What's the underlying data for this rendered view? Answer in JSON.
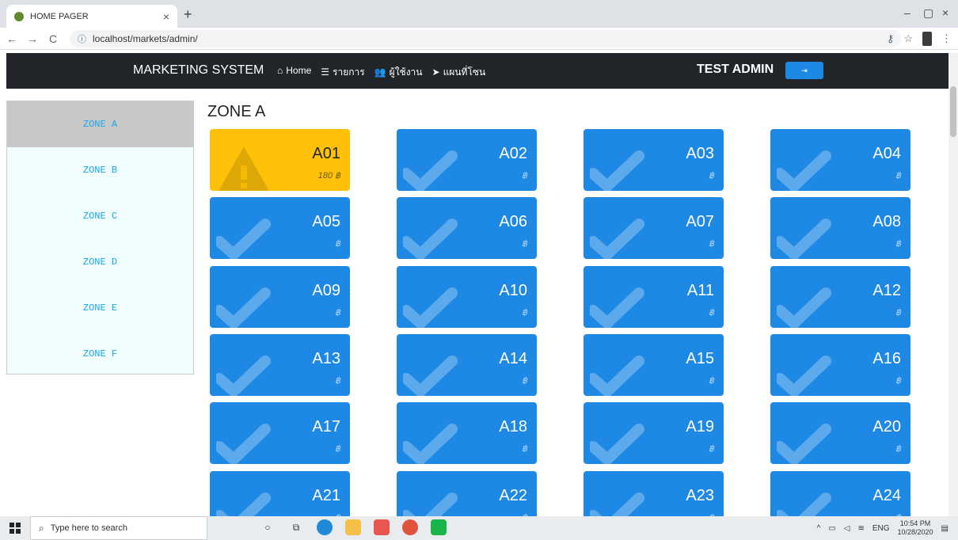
{
  "browser": {
    "tab_title": "HOME PAGER",
    "tab_close": "×",
    "new_tab": "+",
    "url": "localhost/markets/admin/",
    "win_min": "–",
    "win_max": "▢",
    "win_close": "×",
    "back": "←",
    "forward": "→",
    "reload": "C",
    "info": "ⓘ",
    "key": "⚷",
    "star": "☆",
    "menu": "⋮"
  },
  "navbar": {
    "brand": "MARKETING SYSTEM",
    "links": [
      {
        "icon": "home-icon",
        "glyph": "⌂",
        "label": "Home"
      },
      {
        "icon": "list-icon",
        "glyph": "☰",
        "label": "รายการ"
      },
      {
        "icon": "users-icon",
        "glyph": "👥",
        "label": "ผู้ใช้งาน"
      },
      {
        "icon": "send-icon",
        "glyph": "➤",
        "label": "แผนที่โซน"
      }
    ],
    "user": "TEST ADMIN",
    "logout_glyph": "⇥"
  },
  "sidebar": {
    "zones": [
      "ZONE A",
      "ZONE B",
      "ZONE C",
      "ZONE D",
      "ZONE E",
      "ZONE F"
    ],
    "active": "ZONE A"
  },
  "main": {
    "title": "ZONE A",
    "booths": [
      {
        "id": "A01",
        "price": "180 ฿",
        "status": "warning"
      },
      {
        "id": "A02",
        "price": "฿",
        "status": "available"
      },
      {
        "id": "A03",
        "price": "฿",
        "status": "available"
      },
      {
        "id": "A04",
        "price": "฿",
        "status": "available"
      },
      {
        "id": "A05",
        "price": "฿",
        "status": "available"
      },
      {
        "id": "A06",
        "price": "฿",
        "status": "available"
      },
      {
        "id": "A07",
        "price": "฿",
        "status": "available"
      },
      {
        "id": "A08",
        "price": "฿",
        "status": "available"
      },
      {
        "id": "A09",
        "price": "฿",
        "status": "available"
      },
      {
        "id": "A10",
        "price": "฿",
        "status": "available"
      },
      {
        "id": "A11",
        "price": "฿",
        "status": "available"
      },
      {
        "id": "A12",
        "price": "฿",
        "status": "available"
      },
      {
        "id": "A13",
        "price": "฿",
        "status": "available"
      },
      {
        "id": "A14",
        "price": "฿",
        "status": "available"
      },
      {
        "id": "A15",
        "price": "฿",
        "status": "available"
      },
      {
        "id": "A16",
        "price": "฿",
        "status": "available"
      },
      {
        "id": "A17",
        "price": "฿",
        "status": "available"
      },
      {
        "id": "A18",
        "price": "฿",
        "status": "available"
      },
      {
        "id": "A19",
        "price": "฿",
        "status": "available"
      },
      {
        "id": "A20",
        "price": "฿",
        "status": "available"
      },
      {
        "id": "A21",
        "price": "฿",
        "status": "available"
      },
      {
        "id": "A22",
        "price": "฿",
        "status": "available"
      },
      {
        "id": "A23",
        "price": "฿",
        "status": "available"
      },
      {
        "id": "A24",
        "price": "฿",
        "status": "available"
      }
    ]
  },
  "taskbar": {
    "search_placeholder": "Type here to search",
    "lang": "ENG",
    "time": "10:54 PM",
    "date": "10/28/2020"
  },
  "colors": {
    "available": "#1e88e5",
    "warning": "#ffc107",
    "navbar": "#212529"
  }
}
